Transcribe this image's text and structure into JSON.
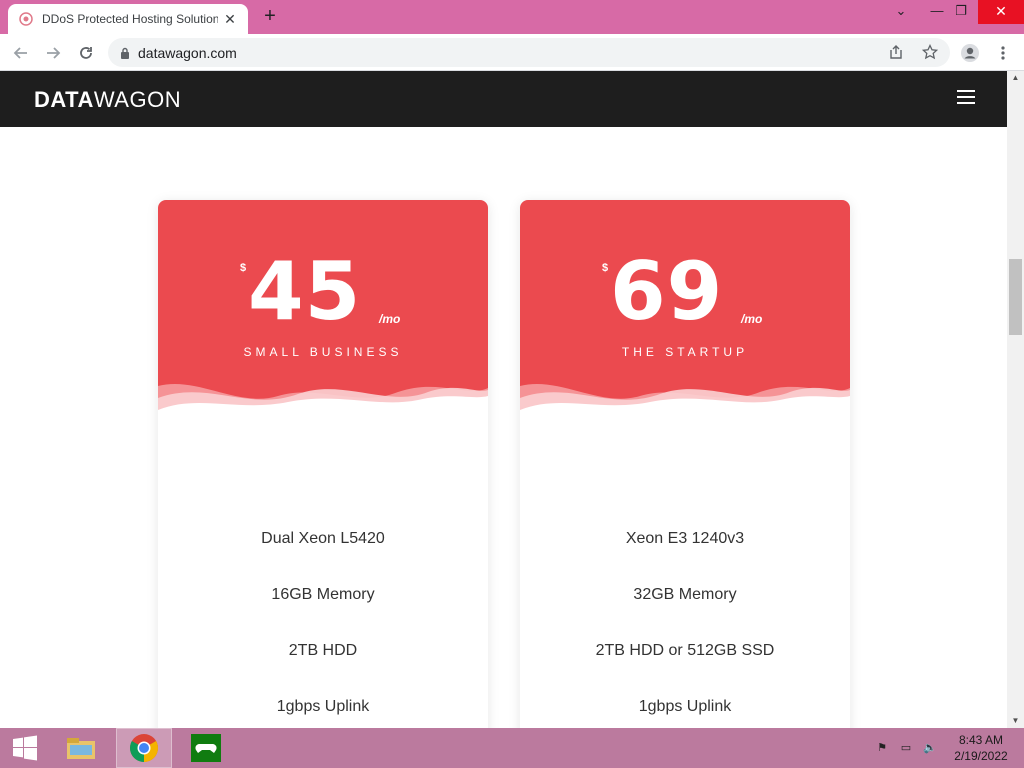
{
  "browser": {
    "tab_title": "DDoS Protected Hosting Solution",
    "tab_close": "✕",
    "new_tab": "+",
    "url": "datawagon.com",
    "win_min": "—",
    "win_restore": "❐",
    "win_close": "✕",
    "tab_dropdown": "⌄"
  },
  "site": {
    "brand_bold": "DATA",
    "brand_light": "WAGON"
  },
  "cards": [
    {
      "currency": "$",
      "price": "45",
      "period": "/mo",
      "plan": "SMALL BUSINESS",
      "features": [
        "Dual Xeon L5420",
        "16GB Memory",
        "2TB HDD",
        "1gbps Uplink"
      ]
    },
    {
      "currency": "$",
      "price": "69",
      "period": "/mo",
      "plan": "THE STARTUP",
      "features": [
        "Xeon E3 1240v3",
        "32GB Memory",
        "2TB HDD or 512GB SSD",
        "1gbps Uplink"
      ]
    }
  ],
  "taskbar": {
    "time": "8:43 AM",
    "date": "2/19/2022"
  },
  "colors": {
    "accent": "#eb4a4f",
    "navbar": "#1e1e1e",
    "tabstrip": "#d76aa6",
    "taskbar": "#bb7a9e"
  }
}
